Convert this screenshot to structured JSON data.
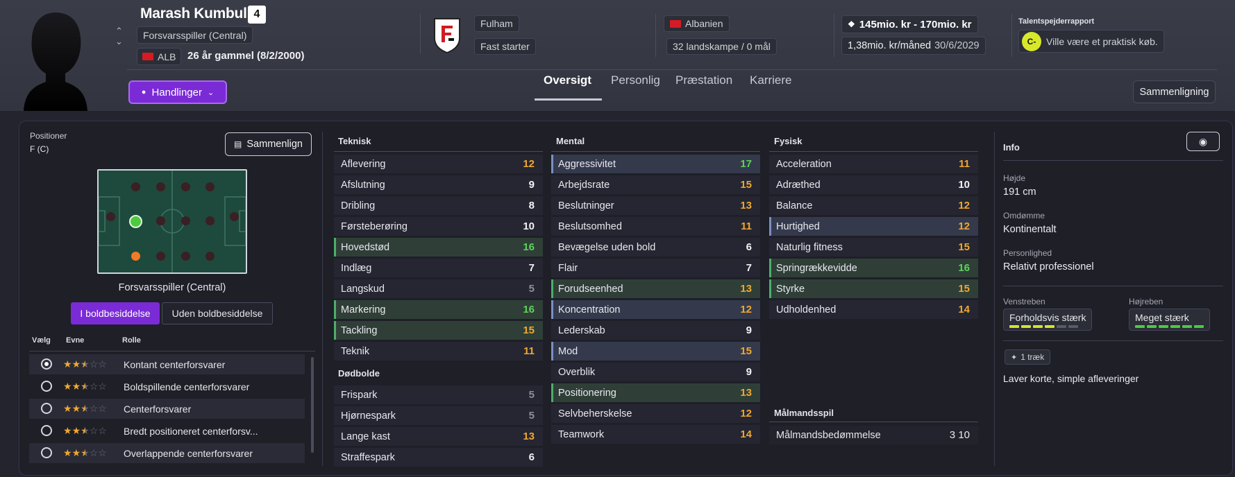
{
  "header": {
    "player_name": "Marash Kumbulla",
    "shirt_number": "4",
    "position_label": "Forsvarsspiller (Central)",
    "nation_code": "ALB",
    "age_text": "26 år gammel (8/2/2000)",
    "club_name": "Fulham",
    "club_status": "Fast starter",
    "nationality": "Albanien",
    "caps": "32 landskampe / 0 mål",
    "value_range": "145mio. kr - 170mio. kr",
    "wage": "1,38mio. kr/måned",
    "contract_end": "30/6/2029",
    "scout_title": "Talentspejderrapport",
    "scout_grade": "C-",
    "scout_text": "Ville være et praktisk køb.",
    "actions_label": "Handlinger",
    "compare_label": "Sammenligning"
  },
  "tabs": [
    "Oversigt",
    "Personlig",
    "Præstation",
    "Karriere"
  ],
  "left": {
    "positions_title": "Positioner",
    "positions_value": "F (C)",
    "compare_btn": "Sammenlign",
    "role_caption": "Forsvarsspiller (Central)",
    "toggle_on": "I boldbesiddelse",
    "toggle_off": "Uden boldbesiddelse",
    "col_choose": "Vælg",
    "col_ability": "Evne",
    "col_role": "Rolle",
    "roles": [
      {
        "name": "Kontant centerforsvarer",
        "stars": 2.5,
        "selected": true
      },
      {
        "name": "Boldspillende centerforsvarer",
        "stars": 2.5,
        "selected": false
      },
      {
        "name": "Centerforsvarer",
        "stars": 2.5,
        "selected": false
      },
      {
        "name": "Bredt positioneret centerforsv...",
        "stars": 2.5,
        "selected": false
      },
      {
        "name": "Overlappende centerforsvarer",
        "stars": 2.5,
        "selected": false
      }
    ]
  },
  "technical": {
    "title": "Teknisk",
    "attrs": [
      {
        "name": "Aflevering",
        "value": "12",
        "color": "orange",
        "hl": ""
      },
      {
        "name": "Afslutning",
        "value": "9",
        "color": "white",
        "hl": ""
      },
      {
        "name": "Dribling",
        "value": "8",
        "color": "white",
        "hl": ""
      },
      {
        "name": "Førsteberøring",
        "value": "10",
        "color": "white",
        "hl": ""
      },
      {
        "name": "Hovedstød",
        "value": "16",
        "color": "green",
        "hl": "g"
      },
      {
        "name": "Indlæg",
        "value": "7",
        "color": "white",
        "hl": ""
      },
      {
        "name": "Langskud",
        "value": "5",
        "color": "gray",
        "hl": ""
      },
      {
        "name": "Markering",
        "value": "16",
        "color": "green",
        "hl": "g"
      },
      {
        "name": "Tackling",
        "value": "15",
        "color": "orange",
        "hl": "g"
      },
      {
        "name": "Teknik",
        "value": "11",
        "color": "orange",
        "hl": ""
      }
    ]
  },
  "setpieces": {
    "title": "Dødbolde",
    "attrs": [
      {
        "name": "Frispark",
        "value": "5",
        "color": "gray",
        "hl": ""
      },
      {
        "name": "Hjørnespark",
        "value": "5",
        "color": "gray",
        "hl": ""
      },
      {
        "name": "Lange kast",
        "value": "13",
        "color": "orange",
        "hl": ""
      },
      {
        "name": "Straffespark",
        "value": "6",
        "color": "white",
        "hl": ""
      }
    ]
  },
  "mental": {
    "title": "Mental",
    "attrs": [
      {
        "name": "Aggressivitet",
        "value": "17",
        "color": "green",
        "hl": "b"
      },
      {
        "name": "Arbejdsrate",
        "value": "15",
        "color": "orange",
        "hl": ""
      },
      {
        "name": "Beslutninger",
        "value": "13",
        "color": "orange",
        "hl": ""
      },
      {
        "name": "Beslutsomhed",
        "value": "11",
        "color": "orange",
        "hl": ""
      },
      {
        "name": "Bevægelse uden bold",
        "value": "6",
        "color": "white",
        "hl": ""
      },
      {
        "name": "Flair",
        "value": "7",
        "color": "white",
        "hl": ""
      },
      {
        "name": "Forudseenhed",
        "value": "13",
        "color": "orange",
        "hl": "g"
      },
      {
        "name": "Koncentration",
        "value": "12",
        "color": "orange",
        "hl": "b"
      },
      {
        "name": "Lederskab",
        "value": "9",
        "color": "white",
        "hl": ""
      },
      {
        "name": "Mod",
        "value": "15",
        "color": "orange",
        "hl": "b"
      },
      {
        "name": "Overblik",
        "value": "9",
        "color": "white",
        "hl": ""
      },
      {
        "name": "Positionering",
        "value": "13",
        "color": "orange",
        "hl": "g"
      },
      {
        "name": "Selvbeherskelse",
        "value": "12",
        "color": "orange",
        "hl": ""
      },
      {
        "name": "Teamwork",
        "value": "14",
        "color": "orange",
        "hl": ""
      }
    ]
  },
  "physical": {
    "title": "Fysisk",
    "attrs": [
      {
        "name": "Acceleration",
        "value": "11",
        "color": "orange",
        "hl": ""
      },
      {
        "name": "Adræthed",
        "value": "10",
        "color": "white",
        "hl": ""
      },
      {
        "name": "Balance",
        "value": "12",
        "color": "orange",
        "hl": ""
      },
      {
        "name": "Hurtighed",
        "value": "12",
        "color": "orange",
        "hl": "b"
      },
      {
        "name": "Naturlig fitness",
        "value": "15",
        "color": "orange",
        "hl": ""
      },
      {
        "name": "Springrækkevidde",
        "value": "16",
        "color": "green",
        "hl": "g"
      },
      {
        "name": "Styrke",
        "value": "15",
        "color": "orange",
        "hl": "g"
      },
      {
        "name": "Udholdenhed",
        "value": "14",
        "color": "orange",
        "hl": ""
      }
    ]
  },
  "goalkeeping": {
    "title": "Målmandsspil",
    "label": "Målmandsbedømmelse",
    "value": "3 10"
  },
  "info": {
    "title": "Info",
    "height_label": "Højde",
    "height_value": "191 cm",
    "rep_label": "Omdømme",
    "rep_value": "Kontinentalt",
    "pers_label": "Personlighed",
    "pers_value": "Relativt professionel",
    "left_foot_label": "Venstreben",
    "left_foot_value": "Forholdsvis stærk",
    "left_foot_level": 4,
    "right_foot_label": "Højreben",
    "right_foot_value": "Meget stærk",
    "right_foot_level": 6,
    "traits_badge": "1 træk",
    "trait_text": "Laver korte, simple afleveringer"
  },
  "colors": {
    "accent": "#7b2bd6",
    "green": "#5ed35a",
    "orange": "#f0a830",
    "gray": "#8d8e98"
  }
}
